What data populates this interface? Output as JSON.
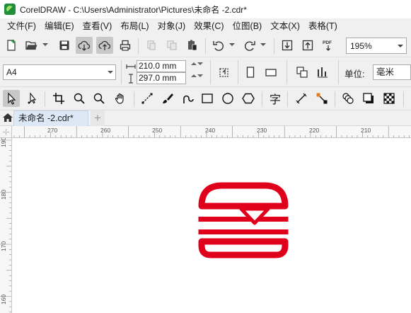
{
  "window": {
    "title": "CorelDRAW - C:\\Users\\Administrator\\Pictures\\未命名 -2.cdr*"
  },
  "menu": [
    {
      "label": "文件(F)"
    },
    {
      "label": "编辑(E)"
    },
    {
      "label": "查看(V)"
    },
    {
      "label": "布局(L)"
    },
    {
      "label": "对象(J)"
    },
    {
      "label": "效果(C)"
    },
    {
      "label": "位图(B)"
    },
    {
      "label": "文本(X)"
    },
    {
      "label": "表格(T)"
    }
  ],
  "toolbar": {
    "zoom": "195%",
    "icons": [
      "new-document-icon",
      "open-folder-icon",
      "save-icon",
      "cloud-download-icon",
      "cloud-upload-icon",
      "print-icon",
      "cut-icon",
      "copy-icon",
      "paste-icon",
      "undo-icon",
      "redo-icon",
      "import-icon",
      "export-icon",
      "pdf-icon"
    ],
    "pdf_label": "PDF"
  },
  "property_bar": {
    "page_size": "A4",
    "width": "210.0 mm",
    "height": "297.0 mm",
    "unit_label": "单位:",
    "unit_value": "毫米"
  },
  "toolbox": {
    "tools": [
      "pick-tool-icon",
      "shape-tool-icon",
      "crop-tool-icon",
      "zoom-tool-icon",
      "zoom-out-tool-icon",
      "pan-tool-icon",
      "freehand-tool-icon",
      "artistic-media-tool-icon",
      "bezier-tool-icon",
      "rectangle-tool-icon",
      "ellipse-tool-icon",
      "polygon-tool-icon",
      "text-tool-icon",
      "parallel-dimension-tool-icon",
      "connector-tool-icon",
      "blend-tool-icon",
      "drop-shadow-tool-icon",
      "transparency-tool-icon"
    ],
    "text_tool_glyph": "字"
  },
  "document_tabs": [
    {
      "label": "未命名 -2.cdr*",
      "active": true
    }
  ],
  "rulers": {
    "horizontal": [
      "270",
      "260",
      "250",
      "240",
      "230",
      "220",
      "210"
    ],
    "vertical": [
      "190",
      "180",
      "170",
      "160"
    ]
  },
  "canvas": {
    "object": "hamburger-logo",
    "object_color": "#e0001b"
  }
}
